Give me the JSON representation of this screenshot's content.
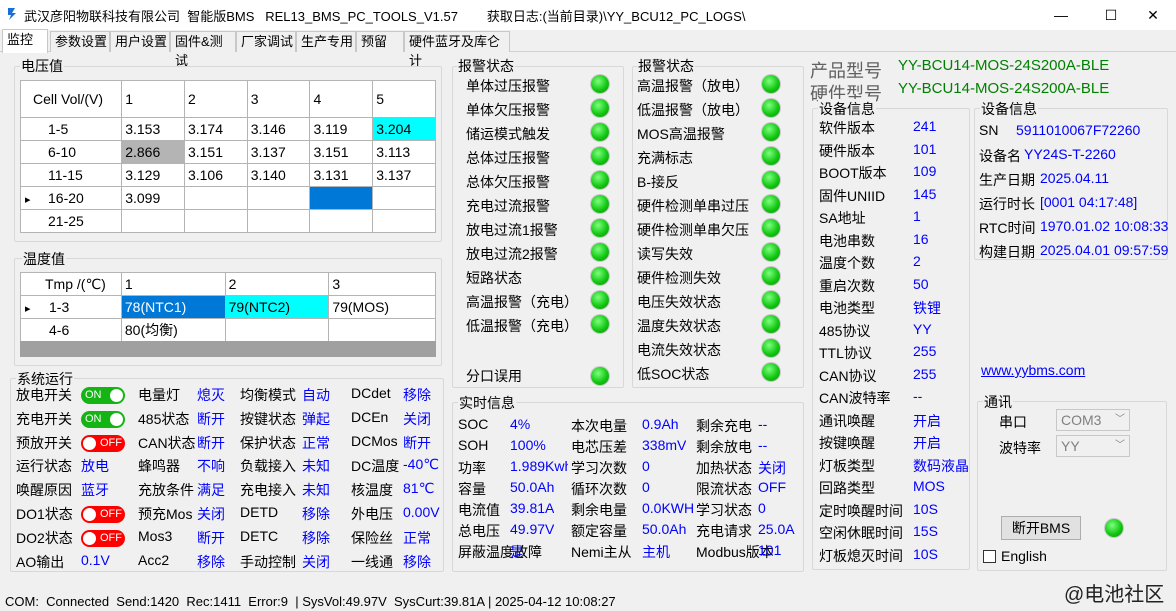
{
  "window": {
    "title": "武汉彦阳物联科技有限公司  智能版BMS   REL13_BMS_PC_TOOLS_V1.57        获取日志:(当前目录)\\YY_BCU12_PC_LOGS\\",
    "minimize": "—",
    "maximize": "☐",
    "close": "✕"
  },
  "tabs": [
    "监控",
    "参数设置",
    "用户设置",
    "固件&测试",
    "厂家调试",
    "生产专用",
    "预留",
    "硬件蓝牙及库仑计"
  ],
  "voltage": {
    "title": "电压值",
    "header": [
      "Cell Vol/(V)",
      "1",
      "2",
      "3",
      "4",
      "5"
    ],
    "rows": [
      [
        "1-5",
        "3.153",
        "3.174",
        "3.146",
        "3.119",
        "3.204"
      ],
      [
        "6-10",
        "2.866",
        "3.151",
        "3.137",
        "3.151",
        "3.113"
      ],
      [
        "11-15",
        "3.129",
        "3.106",
        "3.140",
        "3.131",
        "3.137"
      ],
      [
        "16-20",
        "3.099",
        "",
        "",
        "",
        ""
      ],
      [
        "21-25",
        "",
        "",
        "",
        "",
        ""
      ]
    ],
    "row_marker": "▸"
  },
  "temperature": {
    "title": "温度值",
    "header": [
      "Tmp /(℃)",
      "1",
      "2",
      "3"
    ],
    "rows": [
      [
        "1-3",
        "78(NTC1)",
        "79(NTC2)",
        "79(MOS)"
      ],
      [
        "4-6",
        "80(均衡)",
        "",
        ""
      ]
    ],
    "row_marker": "▸"
  },
  "system": {
    "title": "系统运行",
    "col1": [
      {
        "label": "放电开关",
        "toggle": "ON"
      },
      {
        "label": "充电开关",
        "toggle": "ON"
      },
      {
        "label": "预放开关",
        "toggle": "OFF"
      },
      {
        "label": "运行状态",
        "value": "放电"
      },
      {
        "label": "唤醒原因",
        "value": "蓝牙"
      },
      {
        "label": "DO1状态",
        "toggle": "OFF"
      },
      {
        "label": "DO2状态",
        "toggle": "OFF"
      },
      {
        "label": "AO输出",
        "value": "0.1V"
      }
    ],
    "col2": [
      {
        "label": "电量灯",
        "value": "熄灭"
      },
      {
        "label": "485状态",
        "value": "断开"
      },
      {
        "label": "CAN状态",
        "value": "断开"
      },
      {
        "label": "蜂鸣器",
        "value": "不响"
      },
      {
        "label": "充放条件",
        "value": "满足"
      },
      {
        "label": "预充Mos",
        "value": "关闭"
      },
      {
        "label": "Mos3",
        "value": "断开"
      },
      {
        "label": "Acc2",
        "value": "移除"
      }
    ],
    "col3": [
      {
        "label": "均衡模式",
        "value": "自动"
      },
      {
        "label": "按键状态",
        "value": "弹起"
      },
      {
        "label": "保护状态",
        "value": "正常"
      },
      {
        "label": "负载接入",
        "value": "未知"
      },
      {
        "label": "充电接入",
        "value": "未知"
      },
      {
        "label": "DETD",
        "value": "移除"
      },
      {
        "label": "DETC",
        "value": "移除"
      },
      {
        "label": "手动控制",
        "value": "关闭"
      }
    ],
    "col4": [
      {
        "label": "DCdet",
        "value": "移除"
      },
      {
        "label": "DCEn",
        "value": "关闭"
      },
      {
        "label": "DCMos",
        "value": "断开"
      },
      {
        "label": "DC温度",
        "value": "-40℃"
      },
      {
        "label": "核温度",
        "value": "81℃"
      },
      {
        "label": "外电压",
        "value": "0.00V"
      },
      {
        "label": "保险丝",
        "value": "正常"
      },
      {
        "label": "一线通",
        "value": "移除"
      }
    ]
  },
  "alarm1": {
    "title": "报警状态",
    "items": [
      "单体过压报警",
      "单体欠压报警",
      "储运模式触发",
      "总体过压报警",
      "总体欠压报警",
      "充电过流报警",
      "放电过流1报警",
      "放电过流2报警",
      "短路状态",
      "高温报警（充电）",
      "低温报警（充电）"
    ],
    "extra": "分口误用"
  },
  "alarm2": {
    "title": "报警状态",
    "items": [
      "高温报警（放电）",
      "低温报警（放电）",
      "MOS高温报警",
      "充满标志",
      "B-接反",
      "硬件检测单串过压",
      "硬件检测单串欠压",
      "读写失效",
      "硬件检测失效",
      "电压失效状态",
      "温度失效状态",
      "电流失效状态",
      "低SOC状态"
    ]
  },
  "realtime": {
    "title": "实时信息",
    "rows": [
      [
        {
          "k": "SOC",
          "v": "4%"
        },
        {
          "k": "本次电量",
          "v": "0.9Ah"
        },
        {
          "k": "剩余充电",
          "v": "--"
        }
      ],
      [
        {
          "k": "SOH",
          "v": "100%"
        },
        {
          "k": "电芯压差",
          "v": "338mV"
        },
        {
          "k": "剩余放电",
          "v": "--"
        }
      ],
      [
        {
          "k": "功率",
          "v": "1.989Kwh"
        },
        {
          "k": "学习次数",
          "v": "0"
        },
        {
          "k": "加热状态",
          "v": "关闭"
        }
      ],
      [
        {
          "k": "容量",
          "v": "50.0Ah"
        },
        {
          "k": "循环次数",
          "v": "0"
        },
        {
          "k": "限流状态",
          "v": "OFF"
        }
      ],
      [
        {
          "k": "电流值",
          "v": "39.81A"
        },
        {
          "k": "剩余电量",
          "v": "0.0KWH"
        },
        {
          "k": "学习状态",
          "v": "0"
        }
      ],
      [
        {
          "k": "总电压",
          "v": "49.97V"
        },
        {
          "k": "额定容量",
          "v": "50.0Ah"
        },
        {
          "k": "充电请求",
          "v": "25.0A"
        }
      ],
      [
        {
          "k": "屏蔽温度故障",
          "v": "是"
        },
        {
          "k": "Nemi主从",
          "v": "主机"
        },
        {
          "k": "Modbus版本",
          "v": "101"
        }
      ]
    ]
  },
  "product": {
    "model_label": "产品型号",
    "model_value": "YY-BCU14-MOS-24S200A-BLE",
    "hw_label": "硬件型号",
    "hw_value": "YY-BCU14-MOS-24S200A-BLE"
  },
  "devinfo1": {
    "title": "设备信息",
    "items": [
      {
        "k": "软件版本",
        "v": "241"
      },
      {
        "k": "硬件版本",
        "v": "101"
      },
      {
        "k": "BOOT版本",
        "v": "109"
      },
      {
        "k": "固件UNIID",
        "v": "145"
      },
      {
        "k": "SA地址",
        "v": "1"
      },
      {
        "k": "电池串数",
        "v": "16"
      },
      {
        "k": "温度个数",
        "v": "2"
      },
      {
        "k": "重启次数",
        "v": "50"
      },
      {
        "k": "电池类型",
        "v": "铁锂"
      },
      {
        "k": "485协议",
        "v": "YY"
      },
      {
        "k": "TTL协议",
        "v": "255"
      },
      {
        "k": "CAN协议",
        "v": "255"
      },
      {
        "k": "CAN波特率",
        "v": "--"
      },
      {
        "k": "通讯唤醒",
        "v": "开启"
      },
      {
        "k": "按键唤醒",
        "v": "开启"
      },
      {
        "k": "灯板类型",
        "v": "数码液晶"
      },
      {
        "k": "回路类型",
        "v": "MOS"
      },
      {
        "k": "定时唤醒时间",
        "v": "10S"
      },
      {
        "k": "空闲休眠时间",
        "v": "15S"
      },
      {
        "k": "灯板熄灭时间",
        "v": "10S"
      }
    ]
  },
  "devinfo2": {
    "title": "设备信息",
    "items": [
      {
        "k": "SN",
        "v": "5911010067F72260"
      },
      {
        "k": "设备名",
        "v": "YY24S-T-2260"
      },
      {
        "k": "生产日期",
        "v": "2025.04.11"
      },
      {
        "k": "运行时长",
        "v": "[0001 04:17:48]"
      },
      {
        "k": "RTC时间",
        "v": "1970.01.02 10:08:33"
      },
      {
        "k": "构建日期",
        "v": "2025.04.01 09:57:59"
      }
    ]
  },
  "website": "www.yybms.com",
  "comm": {
    "title": "通讯",
    "port_label": "串口",
    "port_value": "COM3",
    "baud_label": "波特率",
    "baud_value": "YY",
    "disconnect": "断开BMS",
    "english": "English"
  },
  "statusbar": "COM:  Connected  Send:1420  Rec:1411  Error:9  | SysVol:49.97V  SysCurt:39.81A | 2025-04-12 10:08:27",
  "watermark": "@电池社区"
}
